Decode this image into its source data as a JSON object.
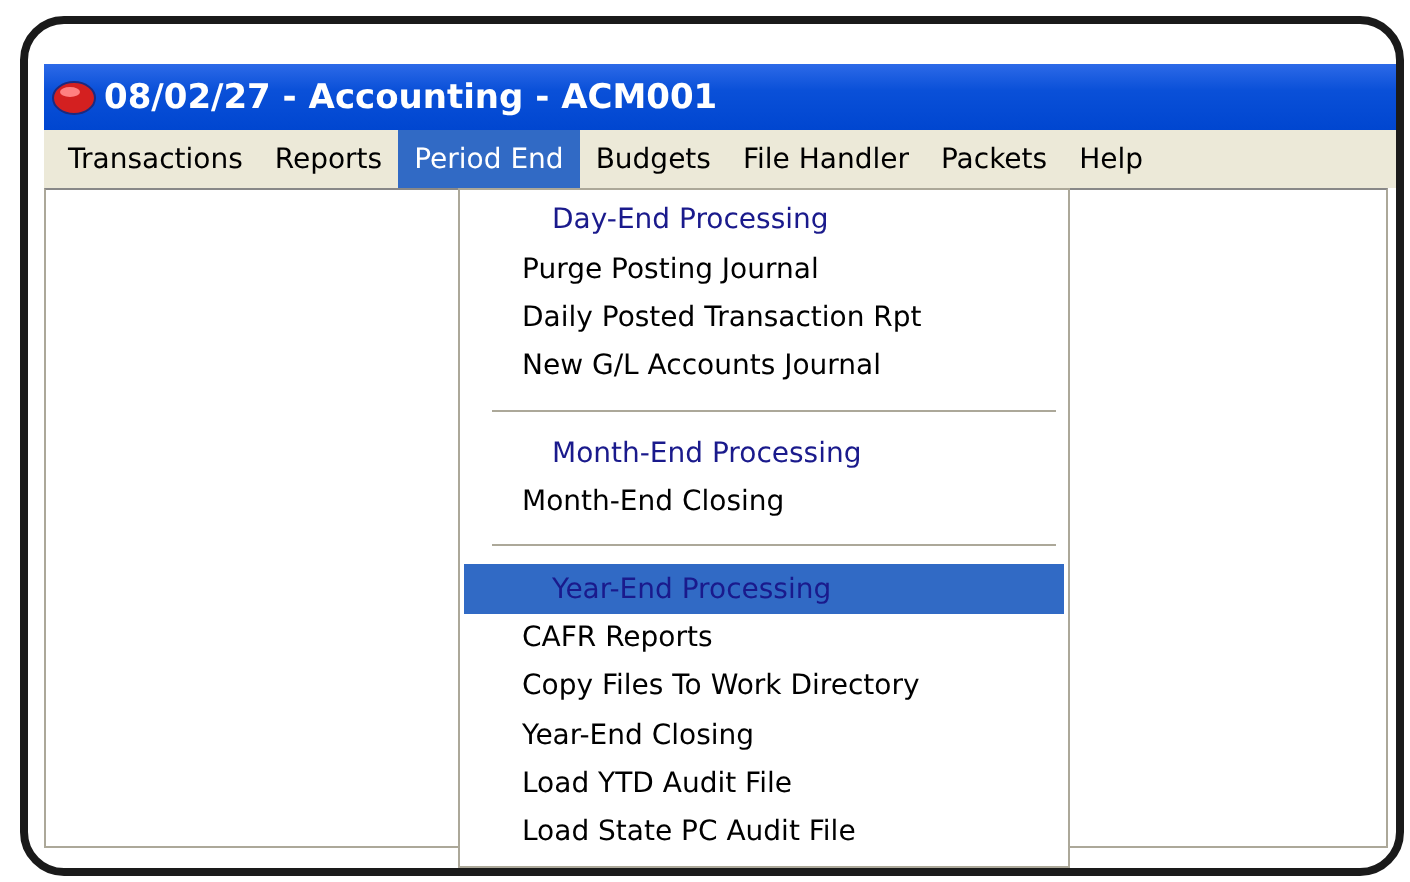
{
  "window": {
    "title": "08/02/27 - Accounting - ACM001"
  },
  "menubar": [
    {
      "label": "Transactions",
      "selected": false
    },
    {
      "label": "Reports",
      "selected": false
    },
    {
      "label": "Period End",
      "selected": true
    },
    {
      "label": "Budgets",
      "selected": false
    },
    {
      "label": "File Handler",
      "selected": false
    },
    {
      "label": "Packets",
      "selected": false
    },
    {
      "label": "Help",
      "selected": false
    }
  ],
  "dropdown": [
    {
      "kind": "header",
      "label": "Day-End Processing",
      "selected": false
    },
    {
      "kind": "item",
      "label": "Purge Posting Journal",
      "selected": false
    },
    {
      "kind": "item",
      "label": "Daily Posted Transaction Rpt",
      "selected": false
    },
    {
      "kind": "item",
      "label": "New G/L Accounts Journal",
      "selected": false
    },
    {
      "kind": "separator"
    },
    {
      "kind": "header",
      "label": "Month-End Processing",
      "selected": false
    },
    {
      "kind": "item",
      "label": "Month-End Closing",
      "selected": false
    },
    {
      "kind": "separator"
    },
    {
      "kind": "header",
      "label": "Year-End Processing",
      "selected": true
    },
    {
      "kind": "item",
      "label": "CAFR Reports",
      "selected": false
    },
    {
      "kind": "item",
      "label": "Copy Files To Work Directory",
      "selected": false
    },
    {
      "kind": "item",
      "label": "Year-End Closing",
      "selected": false
    },
    {
      "kind": "item",
      "label": "Load YTD Audit File",
      "selected": false
    },
    {
      "kind": "item",
      "label": "Load State PC Audit File",
      "selected": false
    }
  ]
}
